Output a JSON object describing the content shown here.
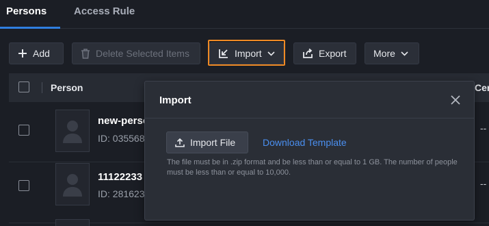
{
  "tabs": [
    {
      "label": "Persons",
      "active": true
    },
    {
      "label": "Access Rule",
      "active": false
    }
  ],
  "toolbar": {
    "add_label": "Add",
    "delete_label": "Delete Selected Items",
    "import_label": "Import",
    "export_label": "Export",
    "more_label": "More"
  },
  "table": {
    "columns": [
      "Person",
      "Certi"
    ],
    "rows": [
      {
        "name": "new-perso",
        "id": "ID: 035568",
        "value": "--"
      },
      {
        "name": "11122233",
        "id": "ID: 281623",
        "value": "--"
      }
    ]
  },
  "modal": {
    "title": "Import",
    "import_file_label": "Import File",
    "download_template_label": "Download Template",
    "hint": "The file must be in .zip format and be less than or equal to 1 GB. The number of people must be less than or equal to 10,000."
  },
  "colors": {
    "accent": "#2f7fe0",
    "highlight": "#f08a24",
    "link": "#4a8ff0",
    "background": "#1b1e25"
  }
}
